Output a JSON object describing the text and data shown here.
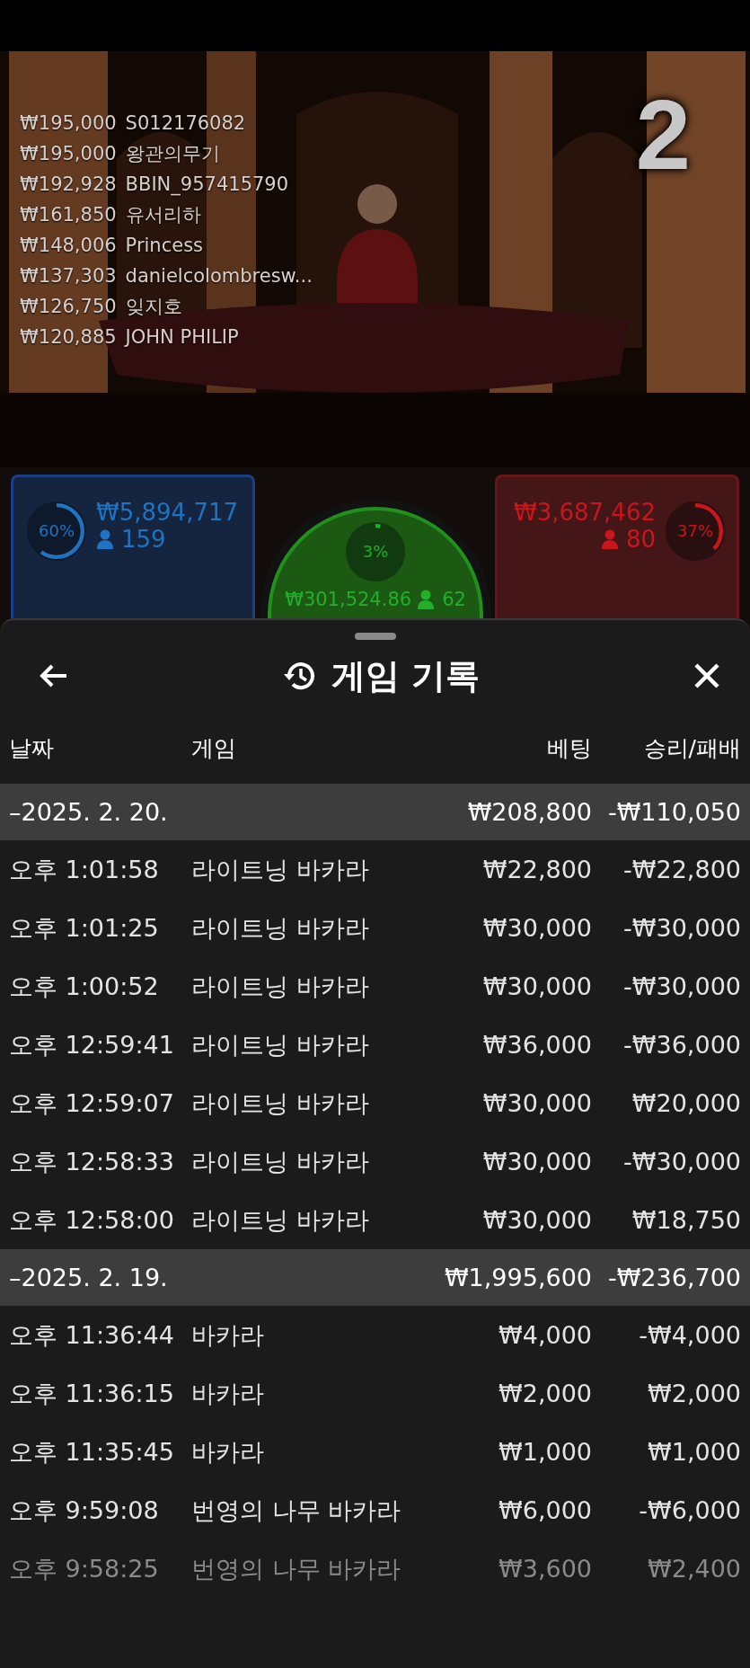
{
  "video": {
    "kind": "picture",
    "countdown": "2",
    "leaderboard": [
      {
        "amount": "₩195,000",
        "name": "S012176082"
      },
      {
        "amount": "₩195,000",
        "name": "왕관의무기"
      },
      {
        "amount": "₩192,928",
        "name": "BBIN_957415790"
      },
      {
        "amount": "₩161,850",
        "name": "유서리하"
      },
      {
        "amount": "₩148,006",
        "name": "Princess"
      },
      {
        "amount": "₩137,303",
        "name": "danielcolombresw..."
      },
      {
        "amount": "₩126,750",
        "name": "잊지호"
      },
      {
        "amount": "₩120,885",
        "name": "JOHN PHILIP"
      }
    ]
  },
  "bets": [
    {
      "kind": "player",
      "percent": "60%",
      "level": 0.6,
      "amount": "₩5,894,717",
      "players": "159"
    },
    {
      "kind": "banker",
      "percent": "37%",
      "level": 0.37,
      "amount": "₩3,687,462",
      "players": "80"
    },
    {
      "kind": "tie",
      "percent": "3%",
      "level": 0.03,
      "amount": "₩301,524.86",
      "players": "62"
    }
  ],
  "sheet": {
    "title": "게임 기록",
    "columns": [
      "날짜",
      "게임",
      "베팅",
      "승리/패배"
    ],
    "groups": [
      {
        "date": "–2025. 2. 20.",
        "bet": "₩208,800",
        "result": "-₩110,050",
        "rows": [
          {
            "time": "오후 1:01:58",
            "game": "라이트닝 바카라",
            "bet": "₩22,800",
            "result": "-₩22,800",
            "faded": false
          },
          {
            "time": "오후 1:01:25",
            "game": "라이트닝 바카라",
            "bet": "₩30,000",
            "result": "-₩30,000",
            "faded": false
          },
          {
            "time": "오후 1:00:52",
            "game": "라이트닝 바카라",
            "bet": "₩30,000",
            "result": "-₩30,000",
            "faded": false
          },
          {
            "time": "오후 12:59:41",
            "game": "라이트닝 바카라",
            "bet": "₩36,000",
            "result": "-₩36,000",
            "faded": false
          },
          {
            "time": "오후 12:59:07",
            "game": "라이트닝 바카라",
            "bet": "₩30,000",
            "result": "₩20,000",
            "faded": false
          },
          {
            "time": "오후 12:58:33",
            "game": "라이트닝 바카라",
            "bet": "₩30,000",
            "result": "-₩30,000",
            "faded": false
          },
          {
            "time": "오후 12:58:00",
            "game": "라이트닝 바카라",
            "bet": "₩30,000",
            "result": "₩18,750",
            "faded": false
          }
        ]
      },
      {
        "date": "–2025. 2. 19.",
        "bet": "₩1,995,600",
        "result": "-₩236,700",
        "rows": [
          {
            "time": "오후 11:36:44",
            "game": "바카라",
            "bet": "₩4,000",
            "result": "-₩4,000",
            "faded": false
          },
          {
            "time": "오후 11:36:15",
            "game": "바카라",
            "bet": "₩2,000",
            "result": "₩2,000",
            "faded": false
          },
          {
            "time": "오후 11:35:45",
            "game": "바카라",
            "bet": "₩1,000",
            "result": "₩1,000",
            "faded": false
          },
          {
            "time": "오후 9:59:08",
            "game": "번영의 나무 바카라",
            "bet": "₩6,000",
            "result": "-₩6,000",
            "faded": false
          },
          {
            "time": "오후 9:58:25",
            "game": "번영의 나무 바카라",
            "bet": "₩3,600",
            "result": "₩2,400",
            "faded": true
          }
        ]
      }
    ]
  }
}
